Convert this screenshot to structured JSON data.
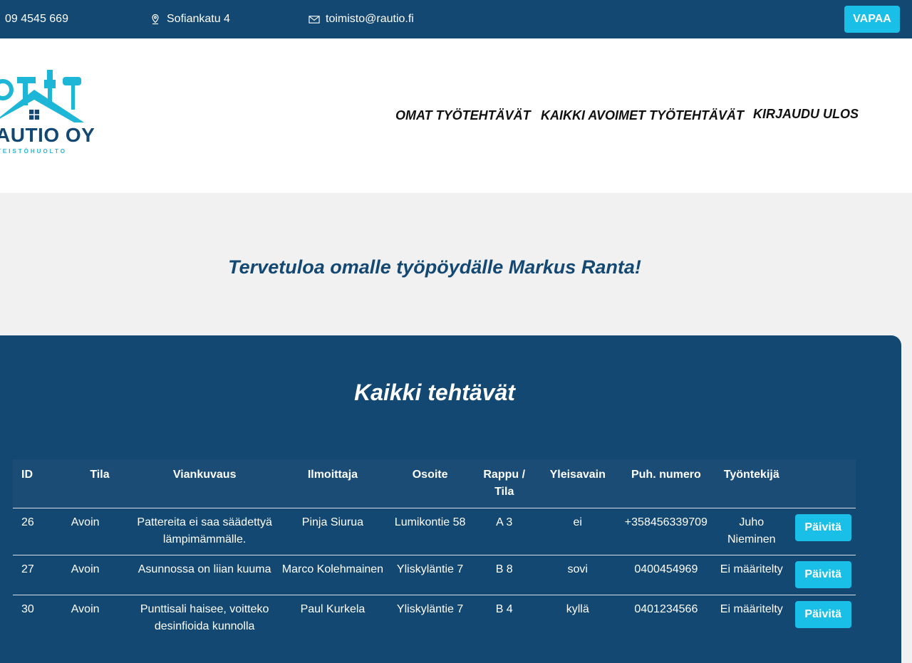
{
  "topbar": {
    "phone": "09 4545 669",
    "address": "Sofiankatu 4",
    "email": "toimisto@rautio.fi",
    "status_button": "VAPAA"
  },
  "header": {
    "logo_text": "AUTIO OY",
    "logo_sub": "TEISTÖHUOLTO",
    "nav": [
      "OMAT TYÖTEHTÄVÄT",
      "KAIKKI AVOIMET TYÖTEHTÄVÄT",
      "KIRJAUDU ULOS"
    ]
  },
  "welcome": "Tervetuloa omalle työpöydälle Markus Ranta!",
  "tasks": {
    "title": "Kaikki tehtävät",
    "columns": [
      "ID",
      "Tila",
      "Viankuvaus",
      "Ilmoittaja",
      "Osoite",
      "Rappu / Tila",
      "Yleisavain",
      "Puh. numero",
      "Työntekijä",
      ""
    ],
    "button_label": "Päivitä",
    "rows": [
      {
        "id": "26",
        "tila": "Avoin",
        "kuvaus": "Pattereita ei saa säädettyä lämpimämmälle.",
        "ilmoittaja": "Pinja Siurua",
        "osoite": "Lumikontie 58",
        "rappu": "A 3",
        "avain": "ei",
        "puh": "+358456339709",
        "tyontekija": "Juho Nieminen"
      },
      {
        "id": "27",
        "tila": "Avoin",
        "kuvaus": "Asunnossa on liian kuuma",
        "ilmoittaja": "Marco Kolehmainen",
        "osoite": "Yliskyläntie 7",
        "rappu": "B 8",
        "avain": "sovi",
        "puh": "0400454969",
        "tyontekija": "Ei määritelty"
      },
      {
        "id": "30",
        "tila": "Avoin",
        "kuvaus": "Punttisali haisee, voitteko desinfioida kunnolla",
        "ilmoittaja": "Paul Kurkela",
        "osoite": "Yliskyläntie 7",
        "rappu": "B 4",
        "avain": "kyllä",
        "puh": "0401234566",
        "tyontekija": "Ei määritelty"
      }
    ]
  }
}
